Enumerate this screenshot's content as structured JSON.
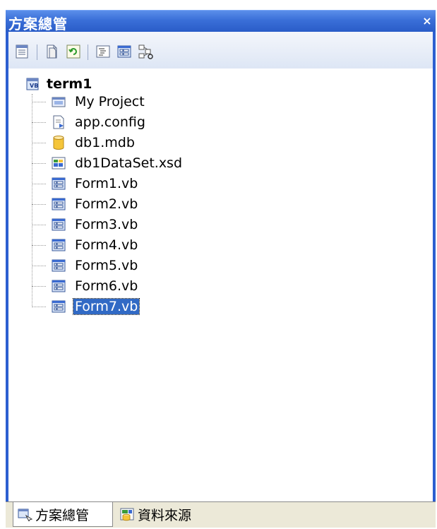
{
  "window": {
    "title": "方案總管",
    "close_glyph": "×"
  },
  "toolbar": {
    "buttons": [
      {
        "icon": "properties-icon"
      },
      {
        "icon": "show-all-files-icon"
      },
      {
        "icon": "refresh-icon"
      },
      {
        "icon": "view-code-icon"
      },
      {
        "icon": "view-designer-icon"
      },
      {
        "icon": "class-diagram-icon"
      }
    ]
  },
  "tree": {
    "root": {
      "label": "term1",
      "icon": "vb-project-icon"
    },
    "items": [
      {
        "label": "My Project",
        "icon": "my-project-icon"
      },
      {
        "label": "app.config",
        "icon": "config-file-icon"
      },
      {
        "label": "db1.mdb",
        "icon": "database-icon"
      },
      {
        "label": "db1DataSet.xsd",
        "icon": "dataset-icon"
      },
      {
        "label": "Form1.vb",
        "icon": "form-icon"
      },
      {
        "label": "Form2.vb",
        "icon": "form-icon"
      },
      {
        "label": "Form3.vb",
        "icon": "form-icon"
      },
      {
        "label": "Form4.vb",
        "icon": "form-icon"
      },
      {
        "label": "Form5.vb",
        "icon": "form-icon"
      },
      {
        "label": "Form6.vb",
        "icon": "form-icon"
      },
      {
        "label": "Form7.vb",
        "icon": "form-icon",
        "selected": true
      }
    ]
  },
  "tabs": [
    {
      "label": "方案總管",
      "icon": "solution-explorer-icon",
      "active": true
    },
    {
      "label": "資料來源",
      "icon": "data-sources-icon",
      "active": false
    }
  ],
  "colors": {
    "title_bar": "#3a6fd8",
    "selection": "#316ac5",
    "border": "#2c5fd0"
  }
}
